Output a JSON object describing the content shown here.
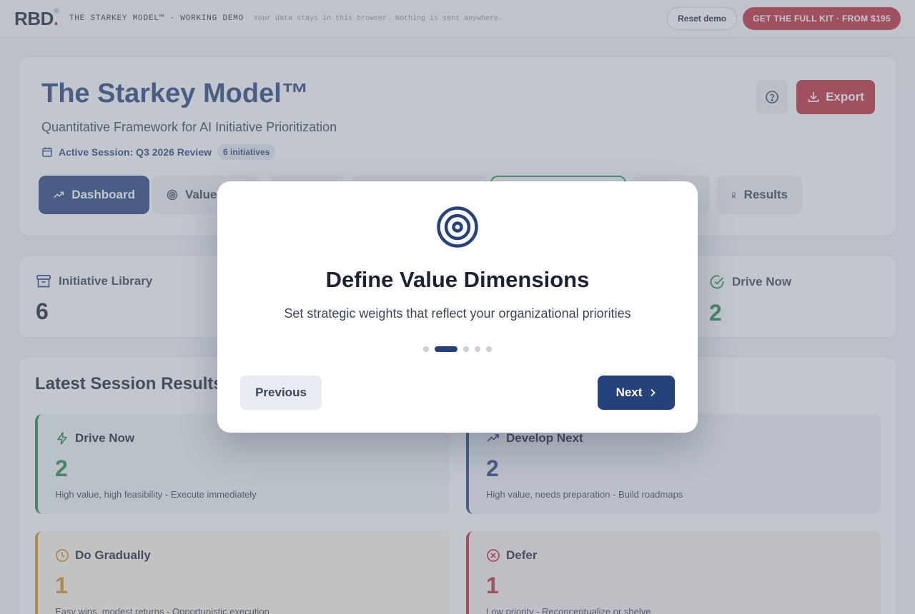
{
  "topbar": {
    "logo": "RBD",
    "logo_dot": ".",
    "demo_label": "THE STARKEY MODEL™ · WORKING DEMO",
    "privacy": "Your data stays in this browser. Nothing is sent anywhere.",
    "reset_label": "Reset demo",
    "kit_label": "GET THE FULL KIT · FROM $195"
  },
  "header": {
    "title": "The Starkey Model™",
    "subtitle": "Quantitative Framework for AI Initiative Prioritization",
    "session_label": "Active Session: Q3 2026 Review",
    "session_badge": "6 initiatives",
    "export_label": "Export"
  },
  "tabs": [
    {
      "label": "Dashboard",
      "icon": "trend-up-icon"
    },
    {
      "label": "Value",
      "icon": "target-icon"
    },
    {
      "label": "Results",
      "icon": "award-icon"
    }
  ],
  "stats": [
    {
      "label": "Initiative Library",
      "value": "6",
      "icon": "archive-icon"
    },
    {
      "label": "Drive Now",
      "value": "2",
      "icon": "check-circle-icon"
    }
  ],
  "results": {
    "title": "Latest Session Results",
    "quadrants": [
      {
        "title": "Drive Now",
        "count": "2",
        "desc": "High value, high feasibility - Execute immediately",
        "icon": "bolt-icon"
      },
      {
        "title": "Develop Next",
        "count": "2",
        "desc": "High value, needs preparation - Build roadmaps",
        "icon": "trend-up-icon"
      },
      {
        "title": "Do Gradually",
        "count": "1",
        "desc": "Easy wins, modest returns - Opportunistic execution",
        "icon": "clock-icon"
      },
      {
        "title": "Defer",
        "count": "1",
        "desc": "Low priority - Reconceptualize or shelve",
        "icon": "x-circle-icon"
      }
    ]
  },
  "modal": {
    "title": "Define Value Dimensions",
    "description": "Set strategic weights that reflect your organizational priorities",
    "step_current": 2,
    "step_total": 5,
    "prev_label": "Previous",
    "next_label": "Next"
  },
  "colors": {
    "brand_navy": "#25427c",
    "brand_red": "#c3283a",
    "drive_now": "#1f8a4c",
    "develop_next": "#25427c",
    "do_gradually": "#d4921a",
    "defer": "#c3283a"
  }
}
